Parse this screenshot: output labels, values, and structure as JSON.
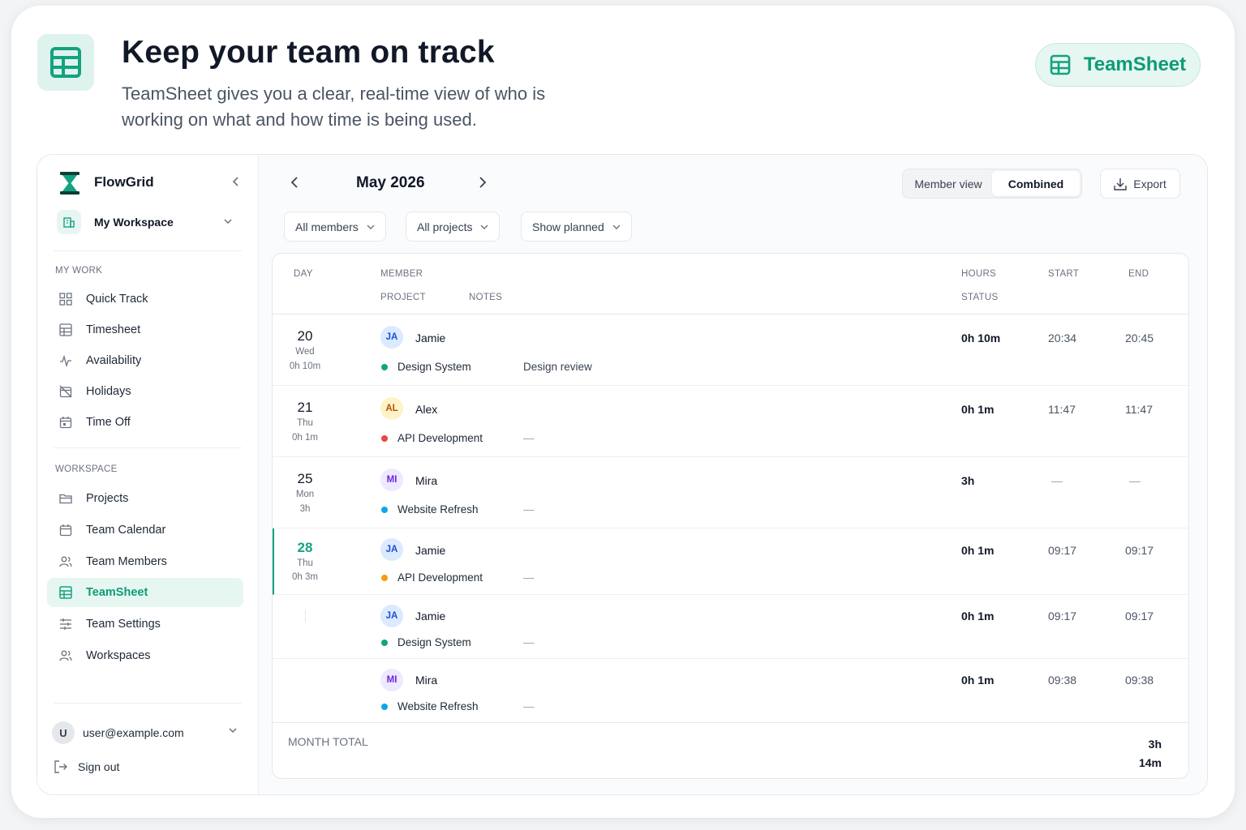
{
  "hero": {
    "title": "Keep your team on track",
    "subtitle": "TeamSheet gives you a clear, real-time view of who is working on what and how time is being used.",
    "brand_label": "TeamSheet"
  },
  "sidebar": {
    "app_name": "FlowGrid",
    "workspace": "My Workspace",
    "my_work_heading": "MY WORK",
    "my_work_items": [
      {
        "label": "Quick Track",
        "icon": "grid-icon"
      },
      {
        "label": "Timesheet",
        "icon": "table-icon"
      },
      {
        "label": "Availability",
        "icon": "activity-icon"
      },
      {
        "label": "Holidays",
        "icon": "calendar-off-icon"
      },
      {
        "label": "Time Off",
        "icon": "calendar-icon"
      }
    ],
    "workspace_heading": "WORKSPACE",
    "workspace_items": [
      {
        "label": "Projects",
        "icon": "folder-icon"
      },
      {
        "label": "Team Calendar",
        "icon": "calendar-icon"
      },
      {
        "label": "Team Members",
        "icon": "users-icon"
      },
      {
        "label": "TeamSheet",
        "icon": "table-icon",
        "active": true
      },
      {
        "label": "Team Settings",
        "icon": "sliders-icon"
      },
      {
        "label": "Workspaces",
        "icon": "users-icon"
      }
    ],
    "user_initial": "U",
    "user_email": "user@example.com",
    "sign_out": "Sign out"
  },
  "toolbar": {
    "month": "May 2026",
    "view_member": "Member view",
    "view_combined": "Combined",
    "view_selected": "Combined",
    "export": "Export",
    "filter_members": "All members",
    "filter_projects": "All projects",
    "filter_planned": "Show planned"
  },
  "table": {
    "headers": {
      "day": "DAY",
      "member": "MEMBER",
      "project": "PROJECT",
      "notes": "NOTES",
      "hours": "HOURS",
      "status": "STATUS",
      "start": "START",
      "end": "END"
    },
    "rows": [
      {
        "day": "20",
        "weekday": "Wed",
        "day_total": "0h 10m",
        "initials": "JA",
        "member": "Jamie",
        "project": "Design System",
        "project_color": "#12a37f",
        "notes": "Design review",
        "hours": "0h 10m",
        "start": "20:34",
        "end": "20:45"
      },
      {
        "day": "21",
        "weekday": "Thu",
        "day_total": "0h 1m",
        "initials": "AL",
        "member": "Alex",
        "project": "API Development",
        "project_color": "#ef4444",
        "notes": "—",
        "hours": "0h 1m",
        "start": "11:47",
        "end": "11:47"
      },
      {
        "day": "25",
        "weekday": "Mon",
        "day_total": "3h",
        "initials": "MI",
        "member": "Mira",
        "project": "Website Refresh",
        "project_color": "#0ea5e9",
        "notes": "—",
        "hours": "3h",
        "start": "—",
        "end": "—"
      },
      {
        "day": "28",
        "weekday": "Thu",
        "day_total": "0h 3m",
        "today": true,
        "initials": "JA",
        "member": "Jamie",
        "project": "API Development",
        "project_color": "#f59e0b",
        "notes": "—",
        "hours": "0h 1m",
        "start": "09:17",
        "end": "09:17"
      },
      {
        "initials": "JA",
        "member": "Jamie",
        "project": "Design System",
        "project_color": "#12a37f",
        "notes": "—",
        "hours": "0h 1m",
        "start": "09:17",
        "end": "09:17"
      },
      {
        "initials": "MI",
        "member": "Mira",
        "project": "Website Refresh",
        "project_color": "#0ea5e9",
        "notes": "—",
        "hours": "0h 1m",
        "start": "09:38",
        "end": "09:38"
      }
    ],
    "month_total_label": "MONTH TOTAL",
    "month_total_value": "3h 14m"
  },
  "colors": {
    "accent": "#0f9b77",
    "accent_soft": "#e6f6f1"
  }
}
